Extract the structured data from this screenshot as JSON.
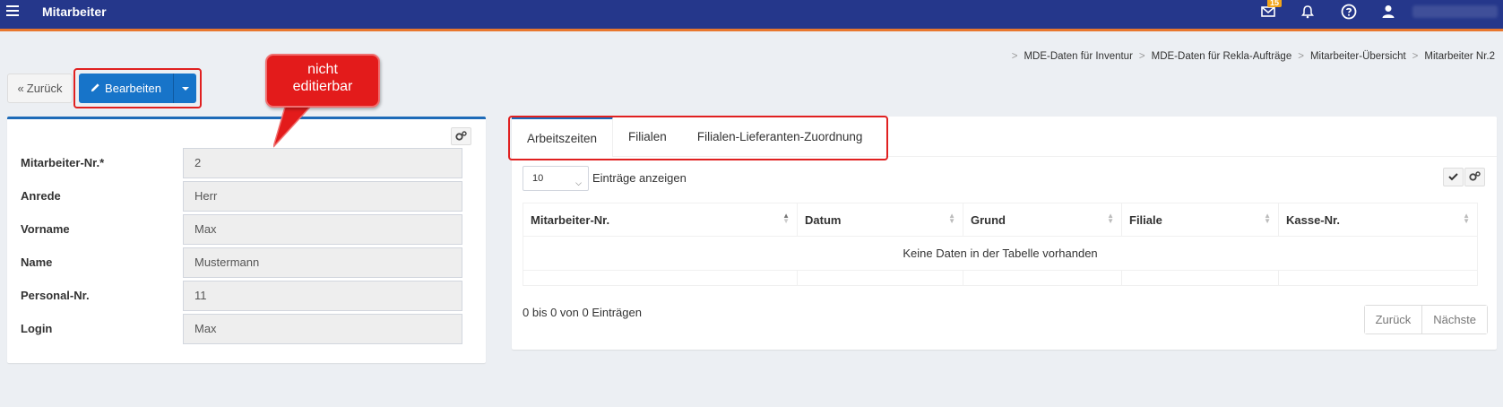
{
  "navbar": {
    "title": "Mitarbeiter",
    "mail_badge": "15",
    "icons": [
      "menu-icon",
      "mail-icon",
      "bell-icon",
      "help-icon",
      "user-icon"
    ]
  },
  "breadcrumb": [
    "MDE-Daten für Inventur",
    "MDE-Daten für Rekla-Aufträge",
    "Mitarbeiter-Übersicht",
    "Mitarbeiter Nr.2"
  ],
  "toolbar": {
    "back_label": "Zurück",
    "edit_label": "Bearbeiten"
  },
  "callout": {
    "line1": "nicht",
    "line2": "editierbar"
  },
  "form": {
    "fields": [
      {
        "label": "Mitarbeiter-Nr.*",
        "value": "2"
      },
      {
        "label": "Anrede",
        "value": "Herr"
      },
      {
        "label": "Vorname",
        "value": "Max"
      },
      {
        "label": "Name",
        "value": "Mustermann"
      },
      {
        "label": "Personal-Nr.",
        "value": "11"
      },
      {
        "label": "Login",
        "value": "Max"
      }
    ]
  },
  "tabs": [
    {
      "label": "Arbeitszeiten",
      "active": true
    },
    {
      "label": "Filialen",
      "active": false
    },
    {
      "label": "Filialen-Lieferanten-Zuordnung",
      "active": false
    }
  ],
  "table": {
    "page_length": "10",
    "page_length_label": "Einträge anzeigen",
    "columns": [
      "Mitarbeiter-Nr.",
      "Datum",
      "Grund",
      "Filiale",
      "Kasse-Nr."
    ],
    "empty_message": "Keine Daten in der Tabelle vorhanden",
    "info": "0 bis 0 von 0 Einträgen",
    "prev_label": "Zurück",
    "next_label": "Nächste"
  },
  "colors": {
    "navbar": "#25378b",
    "navbar_accent": "#e8772e",
    "primary": "#1774c9",
    "highlight": "#e02020"
  }
}
